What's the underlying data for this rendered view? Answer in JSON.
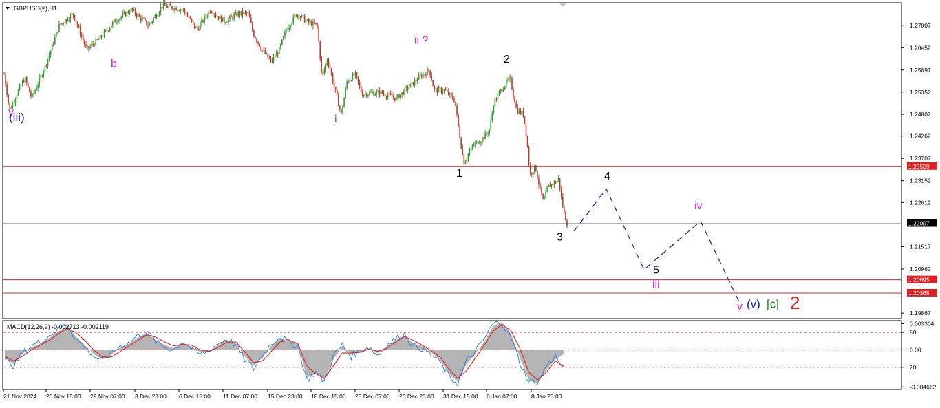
{
  "window": {
    "symbol_title": "GBPUSD(€),H1",
    "indicator_title": "MACD(12,26,9) -0.002713 -0.002119"
  },
  "colors": {
    "background": "#ffffff",
    "axis": "#000000",
    "bull_candle": "#2e9e2e",
    "bear_candle": "#c0392b",
    "level_line": "#e02020",
    "current_line": "#b0b0b0",
    "projection": "#1a1aa8",
    "label_black": "#000000",
    "label_magenta": "#e020e0",
    "label_navy": "#1a1aa8",
    "label_green": "#1a8a1a",
    "label_red": "#e02020",
    "macd_hist": "#b4b4b4",
    "macd_line": "#2080e0",
    "signal_line": "#e02020",
    "macd_level": "#e02020"
  },
  "icons": {
    "dropdown": "triangle-down-icon",
    "scroll_marker": "scroll-marker-icon"
  },
  "chart_data": [
    {
      "type": "candlestick",
      "title": "GBPUSD(€),H1",
      "y_ticks": [
        "1.27007",
        "1.26452",
        "1.25897",
        "1.25352",
        "1.24802",
        "1.24262",
        "1.23707",
        "1.23152",
        "1.22612",
        "1.22097",
        "1.21517",
        "1.20962",
        "1.20695",
        "1.20365",
        "1.19867"
      ],
      "x_ticks": [
        "21 Nov 2024",
        "26 Nov 15:00",
        "29 Nov 07:00",
        "3 Dec 23:00",
        "6 Dec 15:00",
        "11 Dec 07:00",
        "15 Dec 23:00",
        "18 Dec 15:00",
        "23 Dec 07:00",
        "26 Dec 23:00",
        "31 Dec 15:00",
        "6 Jan 07:00",
        "8 Jan 23:00"
      ],
      "ylim": [
        1.1975,
        1.2755
      ],
      "path_anchors": [
        [
          0,
          1.258
        ],
        [
          8,
          1.249
        ],
        [
          18,
          1.253
        ],
        [
          30,
          1.257
        ],
        [
          40,
          1.252
        ],
        [
          60,
          1.26
        ],
        [
          80,
          1.27
        ],
        [
          100,
          1.273
        ],
        [
          120,
          1.264
        ],
        [
          140,
          1.267
        ],
        [
          160,
          1.271
        ],
        [
          185,
          1.274
        ],
        [
          210,
          1.27
        ],
        [
          230,
          1.275
        ],
        [
          260,
          1.274
        ],
        [
          280,
          1.269
        ],
        [
          300,
          1.274
        ],
        [
          320,
          1.271
        ],
        [
          340,
          1.273
        ],
        [
          355,
          1.273
        ],
        [
          362,
          1.268
        ],
        [
          375,
          1.264
        ],
        [
          388,
          1.261
        ],
        [
          400,
          1.264
        ],
        [
          410,
          1.269
        ],
        [
          425,
          1.273
        ],
        [
          440,
          1.271
        ],
        [
          455,
          1.27
        ],
        [
          462,
          1.257
        ],
        [
          470,
          1.262
        ],
        [
          478,
          1.256
        ],
        [
          490,
          1.248
        ],
        [
          498,
          1.256
        ],
        [
          510,
          1.258
        ],
        [
          520,
          1.253
        ],
        [
          545,
          1.2535
        ],
        [
          570,
          1.252
        ],
        [
          590,
          1.255
        ],
        [
          605,
          1.2575
        ],
        [
          618,
          1.259
        ],
        [
          625,
          1.254
        ],
        [
          640,
          1.254
        ],
        [
          655,
          1.2515
        ],
        [
          660,
          1.245
        ],
        [
          668,
          1.236
        ],
        [
          680,
          1.24
        ],
        [
          695,
          1.242
        ],
        [
          705,
          1.244
        ],
        [
          712,
          1.251
        ],
        [
          722,
          1.254
        ],
        [
          735,
          1.257
        ],
        [
          745,
          1.249
        ],
        [
          755,
          1.248
        ],
        [
          760,
          1.241
        ],
        [
          764,
          1.233
        ],
        [
          772,
          1.235
        ],
        [
          778,
          1.23
        ],
        [
          784,
          1.226
        ],
        [
          790,
          1.23
        ],
        [
          800,
          1.231
        ],
        [
          806,
          1.232
        ],
        [
          810,
          1.227
        ],
        [
          813,
          1.224
        ],
        [
          818,
          1.221
        ]
      ],
      "horizontal_levels": [
        {
          "value": 1.23509,
          "label": "1.23509",
          "kind": "level"
        },
        {
          "value": 1.22097,
          "label": "1.22097",
          "kind": "current"
        },
        {
          "value": 1.20695,
          "label": "1.20695",
          "kind": "level"
        },
        {
          "value": 1.20365,
          "label": "1.20365",
          "kind": "level"
        }
      ],
      "projection_path": [
        {
          "label": "3",
          "value": 1.219
        },
        {
          "label": "4",
          "value": 1.2295
        },
        {
          "label": "5",
          "value": 1.2095
        },
        {
          "label": "iv",
          "value": 1.2215
        },
        {
          "label": "v",
          "value": 1.2015
        }
      ],
      "wave_labels": [
        {
          "text": "y",
          "color": "magenta",
          "value": 1.2477,
          "size": 16
        },
        {
          "text": "(iii)",
          "color": "navy",
          "value": 1.2463,
          "size": 17
        },
        {
          "text": "b",
          "color": "magenta",
          "value": 1.2597,
          "size": 16
        },
        {
          "text": "i",
          "color": "magenta",
          "value": 1.246,
          "size": 16
        },
        {
          "text": "ii ?",
          "color": "magenta",
          "value": 1.2655,
          "size": 16
        },
        {
          "text": "1",
          "color": "black",
          "value": 1.2325,
          "size": 16
        },
        {
          "text": "2",
          "color": "black",
          "value": 1.2608,
          "size": 16
        },
        {
          "text": "3",
          "color": "black",
          "value": 1.2167,
          "size": 16
        },
        {
          "text": "4",
          "color": "black",
          "value": 1.2318,
          "size": 16
        },
        {
          "text": "5",
          "color": "black",
          "value": 1.2085,
          "size": 16
        },
        {
          "text": "iii",
          "color": "magenta",
          "value": 1.205,
          "size": 16
        },
        {
          "text": "iv",
          "color": "magenta",
          "value": 1.2245,
          "size": 16
        },
        {
          "text": "v",
          "color": "magenta",
          "value": 1.1995,
          "size": 16
        },
        {
          "text": "(v)",
          "color": "navy",
          "value": 1.2,
          "size": 17
        },
        {
          "text": "[c]",
          "color": "green",
          "value": 1.2,
          "size": 17
        },
        {
          "text": "2",
          "color": "red",
          "value": 1.1997,
          "size": 26
        }
      ]
    },
    {
      "type": "line",
      "title": "MACD(12,26,9) -0.002713 -0.002119",
      "y_ticks": [
        "0.003304",
        "80",
        "0.00",
        "-0.004662"
      ],
      "y_tick_extra": [
        "20"
      ],
      "dashed_levels": [
        0.0022,
        0.0,
        -0.0022
      ],
      "ylim": [
        -0.0049,
        0.0036
      ],
      "series": [
        {
          "name": "MACD histogram",
          "kind": "histogram",
          "values": [
            -0.001,
            -0.0018,
            -0.0005,
            0.0003,
            0.0008,
            0.0015,
            0.0023,
            0.003,
            0.0017,
            0.0006,
            -0.0005,
            -0.0012,
            -0.0006,
            0.0003,
            0.0008,
            0.0016,
            0.0021,
            0.0012,
            0.0006,
            0.0002,
            0.0009,
            0.0004,
            -0.0003,
            -0.0002,
            0.0006,
            0.0012,
            0.0008,
            -0.0008,
            -0.002,
            -0.001,
            0.0005,
            0.0015,
            0.0011,
            0.0008,
            -0.0035,
            -0.003,
            -0.0038,
            -0.0012,
            0.0005,
            -0.0005,
            -0.0003,
            0.0002,
            -0.0004,
            0.0004,
            0.0012,
            0.0018,
            0.0008,
            0.0005,
            -0.0003,
            -0.0012,
            -0.003,
            -0.004,
            -0.0018,
            -0.0005,
            0.001,
            0.003,
            0.0035,
            0.002,
            -0.001,
            -0.0038,
            -0.0042,
            -0.0025,
            -0.0012,
            -0.0005
          ]
        },
        {
          "name": "MACD",
          "kind": "line",
          "values": [
            -0.0012,
            -0.002,
            -0.0004,
            0.0005,
            0.001,
            0.0018,
            0.0026,
            0.0033,
            0.0014,
            0.0004,
            -0.0008,
            -0.0014,
            -0.0004,
            0.0005,
            0.001,
            0.0018,
            0.0023,
            0.001,
            0.0004,
            0.0,
            0.0011,
            0.0002,
            -0.0006,
            0.0,
            0.0008,
            0.0014,
            0.0006,
            -0.0012,
            -0.0024,
            -0.0007,
            0.0008,
            0.0017,
            0.0009,
            0.0005,
            -0.0038,
            -0.0028,
            -0.004,
            -0.0008,
            0.0006,
            -0.0008,
            -0.0001,
            0.0004,
            -0.0007,
            0.0006,
            0.0014,
            0.002,
            0.0005,
            0.0002,
            -0.0006,
            -0.0015,
            -0.0034,
            -0.0042,
            -0.0014,
            -0.0002,
            0.0014,
            0.0033,
            0.0034,
            0.0016,
            -0.0016,
            -0.004,
            -0.0041,
            -0.002,
            -0.0008,
            -0.0027
          ]
        },
        {
          "name": "Signal",
          "kind": "line",
          "values": [
            -0.0008,
            -0.0014,
            -0.0008,
            0.0,
            0.0006,
            0.0012,
            0.002,
            0.0027,
            0.0022,
            0.0012,
            0.0,
            -0.0009,
            -0.0009,
            -0.0002,
            0.0005,
            0.0012,
            0.0019,
            0.0016,
            0.001,
            0.0005,
            0.0007,
            0.0006,
            0.0,
            -0.0002,
            0.0003,
            0.001,
            0.001,
            -0.0002,
            -0.0016,
            -0.0014,
            -0.0002,
            0.001,
            0.0012,
            0.0008,
            -0.002,
            -0.003,
            -0.0036,
            -0.002,
            -0.0004,
            -0.0004,
            -0.0003,
            0.0001,
            -0.0002,
            0.0002,
            0.001,
            0.0017,
            0.0012,
            0.0006,
            -0.0001,
            -0.0009,
            -0.0024,
            -0.0036,
            -0.0026,
            -0.001,
            0.0006,
            0.0024,
            0.0032,
            0.0024,
            0.0002,
            -0.0028,
            -0.0038,
            -0.0028,
            -0.0014,
            -0.0021
          ]
        }
      ]
    }
  ]
}
